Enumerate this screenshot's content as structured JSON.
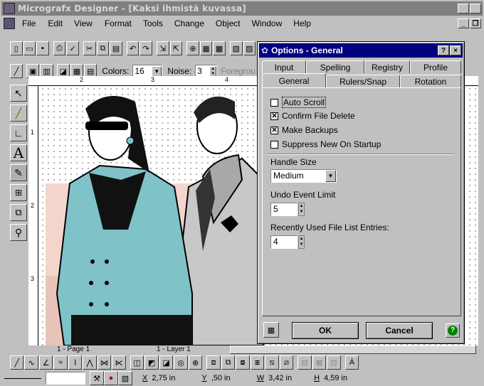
{
  "window": {
    "title": "Micrografx Designer - [Kaksi ihmistä kuvassa]",
    "minimize": "_",
    "maximize": "□"
  },
  "menu": [
    "File",
    "Edit",
    "View",
    "Format",
    "Tools",
    "Change",
    "Object",
    "Window",
    "Help"
  ],
  "style_toolbar": {
    "colors_label": "Colors:",
    "colors_value": "16",
    "noise_label": "Noise:",
    "noise_value": "3",
    "foreground_label": "Foregrou"
  },
  "dialog": {
    "title": "Options - General",
    "help": "?",
    "close": "×",
    "tabs_row1": [
      "Input",
      "Spelling",
      "Registry",
      "Profile"
    ],
    "tabs_row2": [
      "General",
      "Rulers/Snap",
      "Rotation"
    ],
    "active_tab": "General",
    "checkboxes": [
      {
        "label": "Auto Scroll",
        "checked": false
      },
      {
        "label": "Confirm File Delete",
        "checked": true
      },
      {
        "label": "Make Backups",
        "checked": true
      },
      {
        "label": "Suppress New On Startup",
        "checked": false
      }
    ],
    "handle_size_label": "Handle Size",
    "handle_size_value": "Medium",
    "undo_label": "Undo Event Limit",
    "undo_value": "5",
    "recent_label": "Recently Used File List Entries:",
    "recent_value": "4",
    "ok_label": "OK",
    "cancel_label": "Cancel"
  },
  "ruler": {
    "top_marks": [
      "2",
      "3",
      "4"
    ],
    "left_marks": [
      "1",
      "2",
      "3"
    ]
  },
  "page_tabs": {
    "page": "1 - Page 1",
    "layer": "1 - Layer 1"
  },
  "status": {
    "x_label": "X",
    "x_value": "2,75 in",
    "y_label": "Y",
    "y_value": ",50 in",
    "w_label": "W",
    "w_value": "3,42 in",
    "h_label": "H",
    "h_value": "4,59 in"
  },
  "colors": {
    "titlebar_inactive": "#808080",
    "dialog_title": "#000080",
    "jacket": "#7fc3c9",
    "background_pink": "#f3d5cc",
    "help_green": "#008000"
  }
}
